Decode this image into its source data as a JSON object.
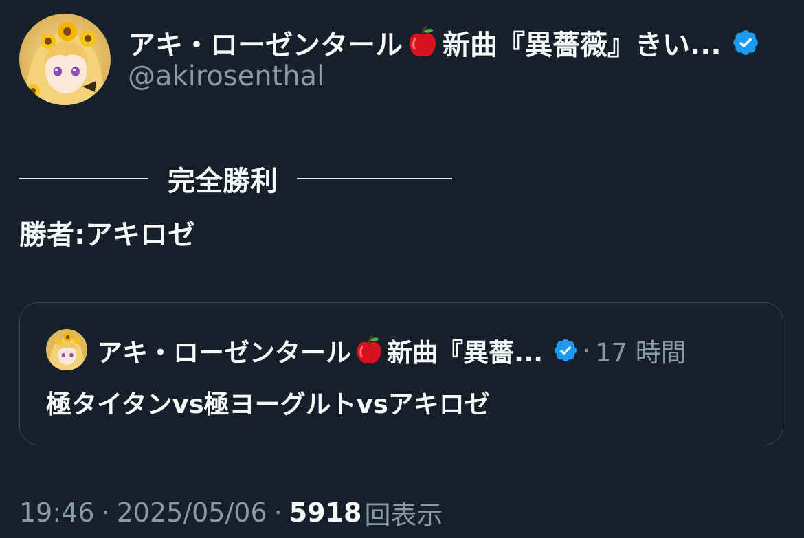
{
  "tweet": {
    "author": {
      "display_name": "アキ・ローゼンタール",
      "name_emoji": "apple-emoji",
      "name_suffix": "新曲『異薔薇』きい...",
      "handle": "@akirosenthal",
      "verified": true,
      "verified_color": "#1d9bf0"
    },
    "body": {
      "line1": "完全勝利",
      "line2": "勝者:アキロゼ"
    },
    "quoted": {
      "display_name": "アキ・ローゼンタール",
      "name_suffix": "新曲『異薔...",
      "separator": "·",
      "time_ago": "17 時間",
      "text": "極タイタンvs極ヨーグルトvsアキロゼ"
    },
    "footer": {
      "time": "19:46",
      "separator": "·",
      "date": "2025/05/06",
      "views_count": "5918",
      "views_label": "回表示"
    }
  },
  "colors": {
    "background": "#15202b",
    "text_primary": "#f7f9f9",
    "text_secondary": "#8b98a5",
    "border": "#38444d",
    "accent": "#1d9bf0"
  }
}
